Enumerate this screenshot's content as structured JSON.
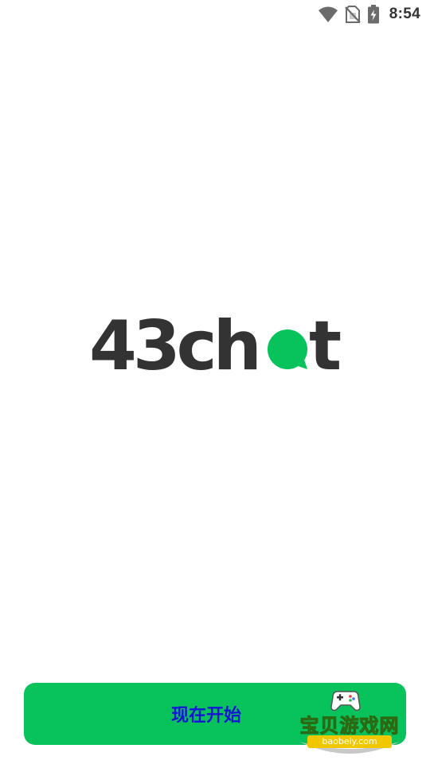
{
  "status_bar": {
    "time": "8:54",
    "icons": [
      "wifi-icon",
      "no-sim-icon",
      "battery-charging-icon"
    ]
  },
  "logo": {
    "text_prefix": "43ch",
    "text_suffix": "t",
    "bubble_color": "#08c35c",
    "text_color": "#333333"
  },
  "start_button": {
    "label": "现在开始",
    "background": "#08c35c",
    "label_color": "#1414d4"
  },
  "watermark": {
    "name": "宝贝游戏网",
    "url": "baobeiy.com"
  }
}
